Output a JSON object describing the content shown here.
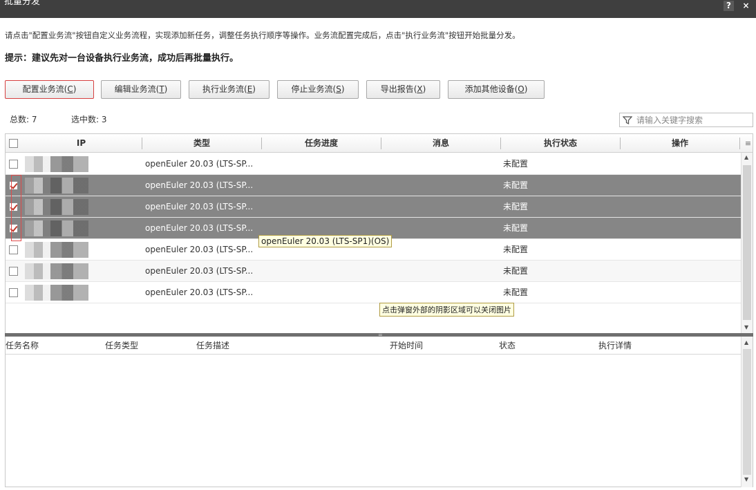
{
  "window": {
    "title": "批量分发",
    "help": "?",
    "close": "×"
  },
  "intro": "请点击\"配置业务流\"按钮自定义业务流程，实现添加新任务，调整任务执行顺序等操作。业务流配置完成后，点击\"执行业务流\"按钮开始批量分发。",
  "hint": "提示：建议先对一台设备执行业务流，成功后再批量执行。",
  "toolbar": [
    {
      "label": "配置业务流",
      "key": "C"
    },
    {
      "label": "编辑业务流",
      "key": "T"
    },
    {
      "label": "执行业务流",
      "key": "E"
    },
    {
      "label": "停止业务流",
      "key": "S"
    },
    {
      "label": "导出报告",
      "key": "X"
    },
    {
      "label": "添加其他设备",
      "key": "O"
    }
  ],
  "counts": {
    "total_label": "总数:",
    "total": "7",
    "selected_label": "选中数:",
    "selected": "3"
  },
  "search": {
    "placeholder": "请输入关键字搜索"
  },
  "device_table": {
    "columns": [
      "IP",
      "类型",
      "任务进度",
      "消息",
      "执行状态",
      "操作"
    ],
    "rows": [
      {
        "type": "openEuler 20.03 (LTS-SP...",
        "status": "未配置",
        "selected": false
      },
      {
        "type": "openEuler 20.03 (LTS-SP...",
        "status": "未配置",
        "selected": true
      },
      {
        "type": "openEuler 20.03 (LTS-SP...",
        "status": "未配置",
        "selected": true
      },
      {
        "type": "openEuler 20.03 (LTS-SP...",
        "status": "未配置",
        "selected": true
      },
      {
        "type": "openEuler 20.03 (LTS-SP...",
        "status": "未配置",
        "selected": false
      },
      {
        "type": "openEuler 20.03 (LTS-SP...",
        "status": "未配置",
        "selected": false
      },
      {
        "type": "openEuler 20.03 (LTS-SP...",
        "status": "未配置",
        "selected": false
      }
    ]
  },
  "tooltip_type": "openEuler 20.03 (LTS-SP1)(OS)",
  "tooltip_close": "点击弹窗外部的阴影区域可以关闭图片",
  "task_table": {
    "columns": [
      "任务名称",
      "任务类型",
      "任务描述",
      "开始时间",
      "状态",
      "执行详情"
    ]
  },
  "colors": {
    "titlebar": "#3f3f3f",
    "selected_row": "#868686",
    "accent_border": "#d64040"
  }
}
